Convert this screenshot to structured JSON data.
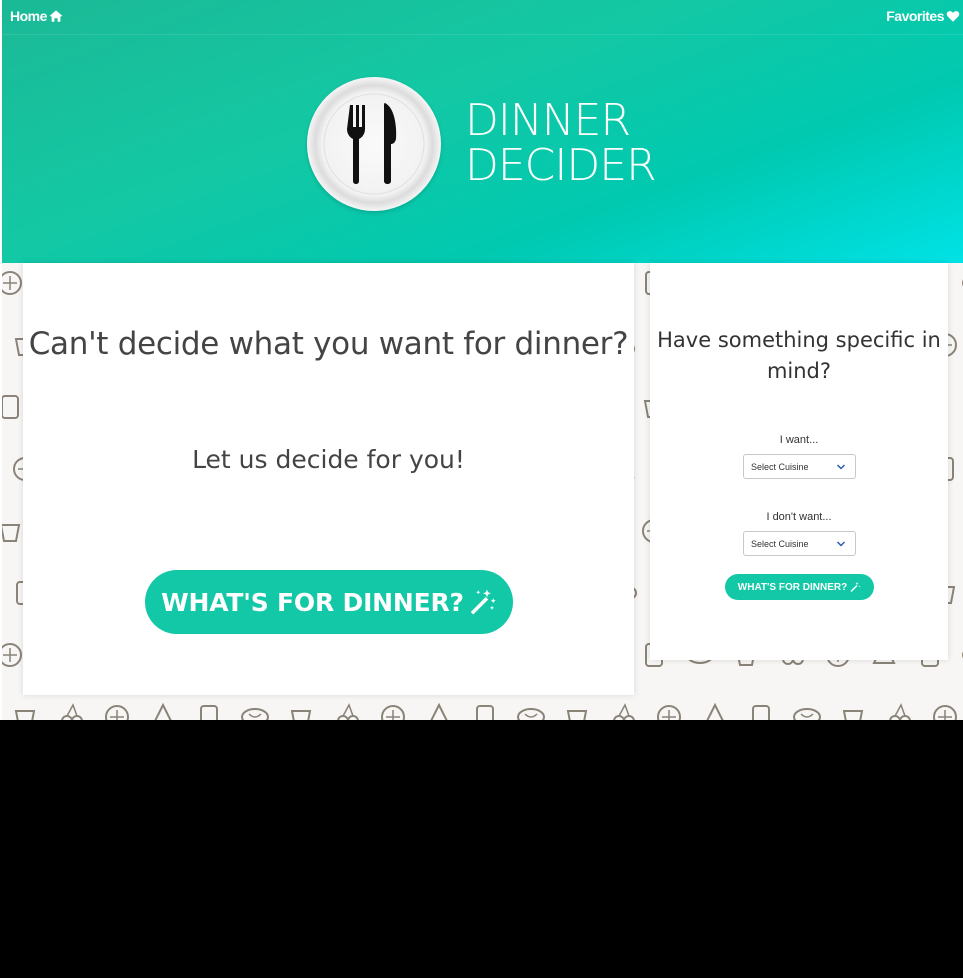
{
  "nav": {
    "home_label": "Home",
    "home_icon": "home-icon",
    "favorites_label": "Favorites",
    "favorites_icon": "heart-icon"
  },
  "logo": {
    "line1": "DINNER",
    "line2": "DECIDER",
    "icon": "fork-knife-plate-icon"
  },
  "main_card": {
    "title": "Can't decide what you want for dinner?",
    "subtitle": "Let us decide for you!",
    "button_label": "WHAT'S FOR DINNER?",
    "button_icon": "magic-wand-icon"
  },
  "side_card": {
    "title": "Have something specific in mind?",
    "want_label": "I want...",
    "want_select": "Select Cuisine",
    "dont_want_label": "I don't want...",
    "dont_want_select": "Select Cuisine",
    "button_label": "WHAT'S FOR DINNER?",
    "button_icon": "magic-wand-icon"
  },
  "colors": {
    "accent": "#12c8a6",
    "hero_start": "#1bb996",
    "hero_end": "#00e2e6",
    "text": "#444444"
  }
}
